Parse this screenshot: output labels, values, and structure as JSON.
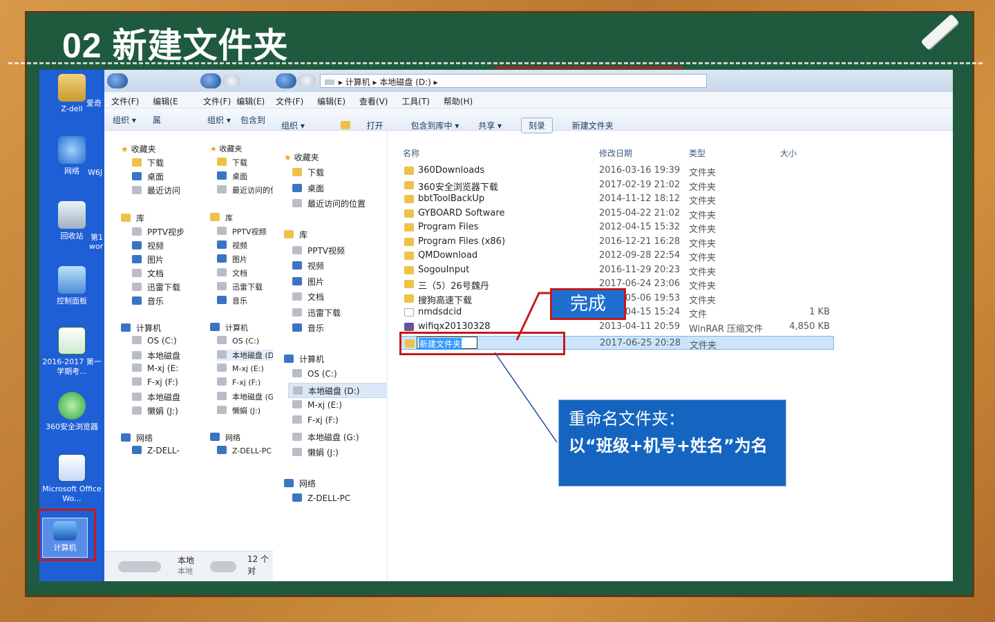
{
  "slide": {
    "title": "02 新建文件夹"
  },
  "desktop": {
    "icons": [
      {
        "label": "Z-dell",
        "icon": "user-folder-icon"
      },
      {
        "label": "网络",
        "icon": "network-icon"
      },
      {
        "label": "回收站",
        "icon": "recycle-bin-icon"
      },
      {
        "label": "控制面板",
        "icon": "control-panel-icon"
      },
      {
        "label": "2016-2017 第一学期考...",
        "icon": "excel-icon"
      },
      {
        "label": "360安全浏览器",
        "icon": "browser-360-icon"
      },
      {
        "label": "Microsoft Office Wo...",
        "icon": "word-icon"
      },
      {
        "label": "计算机",
        "icon": "computer-icon"
      }
    ],
    "partial": [
      "爱奇",
      "W6J",
      "第1",
      "wor"
    ]
  },
  "win1": {
    "menu": [
      "文件(F)",
      "编辑(E"
    ],
    "toolbar": [
      "组织 ▾",
      "属"
    ],
    "favorites": "收藏夹",
    "fav_items": [
      "下载",
      "桌面",
      "最近访问"
    ],
    "library": "库",
    "lib_items": [
      "PPTV视步",
      "视频",
      "图片",
      "文档",
      "迅雷下载",
      "音乐"
    ],
    "computer": "计算机",
    "drives": [
      "OS (C:)",
      "本地磁盘",
      "M-xj (E:",
      "F-xj (F:)",
      "本地磁盘",
      "懒娟 (J:)"
    ],
    "network": "网络",
    "net_items": [
      "Z-DELL-"
    ],
    "status1": "本地",
    "status2": "本地"
  },
  "win2": {
    "menu": [
      "文件(F)",
      "编辑(E)"
    ],
    "toolbar": [
      "组织 ▾",
      "包含到"
    ],
    "favorites": "收藏夹",
    "fav_items": [
      "下载",
      "桌面",
      "最近访问的位"
    ],
    "library": "库",
    "lib_items": [
      "PPTV视频",
      "视频",
      "图片",
      "文档",
      "迅雷下载",
      "音乐"
    ],
    "computer": "计算机",
    "drives": [
      "OS (C:)",
      "本地磁盘 (D:",
      "M-xj (E:)",
      "F-xj (F:)",
      "本地磁盘 (G:",
      "懒娟 (J:)"
    ],
    "network": "网络",
    "net_items": [
      "Z-DELL-PC"
    ],
    "status": "12 个对"
  },
  "win3": {
    "breadcrumb": [
      "计算机",
      "本地磁盘 (D:)"
    ],
    "menu": [
      "文件(F)",
      "编辑(E)",
      "查看(V)",
      "工具(T)",
      "帮助(H)"
    ],
    "toolbar": [
      "组织 ▾",
      "打开",
      "包含到库中 ▾",
      "共享 ▾",
      "刻录",
      "新建文件夹"
    ],
    "favorites": "收藏夹",
    "fav_items": [
      "下载",
      "桌面",
      "最近访问的位置"
    ],
    "library": "库",
    "lib_items": [
      "PPTV视频",
      "视频",
      "图片",
      "文档",
      "迅雷下载",
      "音乐"
    ],
    "computer": "计算机",
    "drives": [
      "OS (C:)",
      "本地磁盘 (D:)",
      "M-xj (E:)",
      "F-xj (F:)",
      "本地磁盘 (G:)",
      "懒娟 (J:)"
    ],
    "network": "网络",
    "net_items": [
      "Z-DELL-PC"
    ],
    "columns": [
      "名称",
      "修改日期",
      "类型",
      "大小"
    ],
    "rows": [
      {
        "name": "360Downloads",
        "date": "2016-03-16 19:39",
        "type": "文件夹",
        "size": ""
      },
      {
        "name": "360安全浏览器下载",
        "date": "2017-02-19 21:02",
        "type": "文件夹",
        "size": ""
      },
      {
        "name": "bbtToolBackUp",
        "date": "2014-11-12 18:12",
        "type": "文件夹",
        "size": ""
      },
      {
        "name": "GYBOARD Software",
        "date": "2015-04-22 21:02",
        "type": "文件夹",
        "size": ""
      },
      {
        "name": "Program Files",
        "date": "2012-04-15 15:32",
        "type": "文件夹",
        "size": ""
      },
      {
        "name": "Program Files (x86)",
        "date": "2016-12-21 16:28",
        "type": "文件夹",
        "size": ""
      },
      {
        "name": "QMDownload",
        "date": "2012-09-28 22:54",
        "type": "文件夹",
        "size": ""
      },
      {
        "name": "SogouInput",
        "date": "2016-11-29 20:23",
        "type": "文件夹",
        "size": ""
      },
      {
        "name": "三（5）26号魏丹",
        "date": "2017-06-24 23:06",
        "type": "文件夹",
        "size": ""
      },
      {
        "name": "搜狗高速下载",
        "date": "2017-05-06 19:53",
        "type": "文件夹",
        "size": ""
      },
      {
        "name": "nmdsdcid",
        "date": "2017-04-15 15:24",
        "type": "文件",
        "size": "1 KB"
      },
      {
        "name": "wifiqx20130328",
        "date": "2013-04-11 20:59",
        "type": "WinRAR 压缩文件",
        "size": "4,850 KB"
      }
    ],
    "new_row": {
      "name": "新建文件夹",
      "date": "2017-06-25 20:28",
      "type": "文件夹"
    }
  },
  "callouts": {
    "done": "完成",
    "rename_title": "重命名文件夹：",
    "rename_rule": "以“班级+机号+姓名”为名"
  },
  "colors": {
    "board": "#1f5a3f",
    "callout": "#1565c0",
    "highlight": "#c41a1a",
    "desktop": "#1f5fd6"
  }
}
